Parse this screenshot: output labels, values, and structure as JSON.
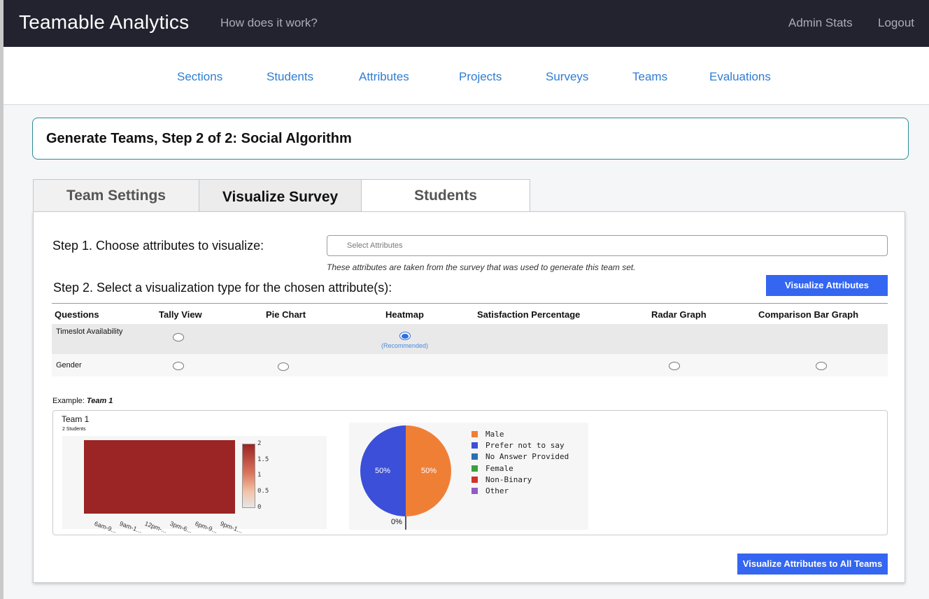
{
  "topbar": {
    "brand": "Teamable Analytics",
    "how_it_works": "How does it work?",
    "admin_stats": "Admin Stats",
    "logout": "Logout"
  },
  "subnav": {
    "items": [
      "Sections",
      "Students",
      "Attributes",
      "Projects",
      "Surveys",
      "Teams",
      "Evaluations"
    ]
  },
  "page": {
    "title": "Generate Teams, Step 2 of 2: Social Algorithm"
  },
  "tabs": [
    {
      "label": "Team Settings",
      "active": false
    },
    {
      "label": "Visualize Survey",
      "active": true
    },
    {
      "label": "Students",
      "active": false
    }
  ],
  "step1": {
    "label": "Step 1. Choose attributes to visualize:",
    "placeholder": "Select Attributes",
    "hint": "These attributes are taken from the survey that was used to generate this team set."
  },
  "step2": {
    "label": "Step 2. Select a visualization type for the chosen attribute(s):",
    "button": "Visualize Attributes"
  },
  "table": {
    "headers": [
      "Questions",
      "Tally View",
      "Pie Chart",
      "Heatmap",
      "Satisfaction Percentage",
      "Radar Graph",
      "Comparison Bar Graph"
    ],
    "rows": [
      {
        "question": "Timeslot Availability",
        "options": {
          "tally": true,
          "heatmap": true
        },
        "selected": "heatmap",
        "recommended": "(Recommended)"
      },
      {
        "question": "Gender",
        "options": {
          "tally": true,
          "pie": true,
          "radar": true,
          "comparison": true
        },
        "selected": null
      }
    ]
  },
  "example": {
    "prefix": "Example: ",
    "team": "Team 1",
    "card_title": "Team 1",
    "card_subtitle": "2 Students"
  },
  "heatmap": {
    "colorbar_ticks": [
      "2",
      "1.5",
      "1",
      "0.5",
      "0"
    ],
    "x_ticks": [
      "6am-9...",
      "9am-1...",
      "12pm-...",
      "3pm-6...",
      "6pm-9...",
      "9pm-1..."
    ]
  },
  "pie": {
    "slices": [
      {
        "label": "Male",
        "percent": "50%",
        "color": "#f07f36"
      },
      {
        "label": "Prefer not to say",
        "percent": "50%",
        "color": "#3b4fd8"
      }
    ],
    "zero_label": "0%",
    "legend": [
      {
        "label": "Male",
        "color": "#f07f36"
      },
      {
        "label": "Prefer not to say",
        "color": "#3b4fd8"
      },
      {
        "label": "No Answer Provided",
        "color": "#2e6fb0"
      },
      {
        "label": "Female",
        "color": "#3aa23a"
      },
      {
        "label": "Non-Binary",
        "color": "#d0322d"
      },
      {
        "label": "Other",
        "color": "#8e5dc4"
      }
    ]
  },
  "actions": {
    "visualize_all": "Visualize Attributes to All Teams"
  }
}
